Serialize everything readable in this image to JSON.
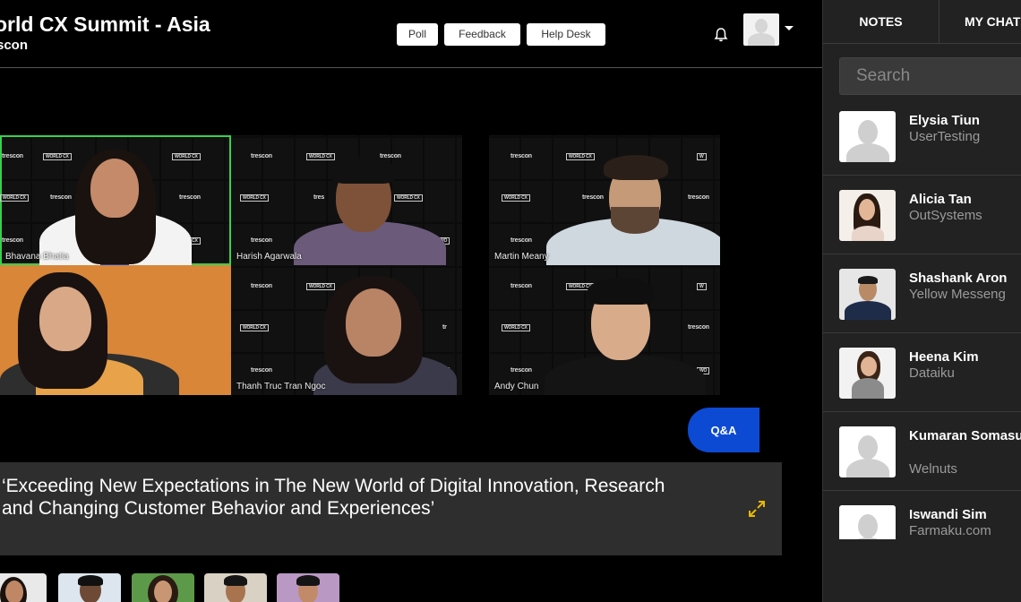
{
  "event": {
    "title": "orld CX Summit - Asia",
    "organizer": "scon"
  },
  "header": {
    "buttons": [
      "Poll",
      "Feedback",
      "Help Desk"
    ],
    "icons": [
      "bell-icon",
      "user-avatar",
      "caret-down-icon"
    ]
  },
  "stage": {
    "backdrop_brand": "trescon",
    "backdrop_logo": "WORLD CX SUMMIT",
    "speakers": [
      {
        "name": "Bhavana Bhatia",
        "active": true
      },
      {
        "name": "Harish Agarwala",
        "active": false
      },
      {
        "name": "Martin Meany",
        "active": false
      },
      {
        "name": "",
        "active": false
      },
      {
        "name": "Thanh Truc Tran Ngoc",
        "active": false
      },
      {
        "name": "Andy Chun",
        "active": false
      }
    ],
    "qa_label": "Q&A"
  },
  "session": {
    "title": "‘Exceeding New Expectations in The New World of Digital Innovation, Research and Changing Customer Behavior and Experiences’"
  },
  "panel": {
    "tabs": [
      "NOTES",
      "MY CHAT"
    ],
    "search_placeholder": "Search",
    "attendees": [
      {
        "name": "Elysia Tiun",
        "company": "UserTesting",
        "photo": false
      },
      {
        "name": "Alicia Tan",
        "company": "OutSystems",
        "photo": true
      },
      {
        "name": "Shashank Aron",
        "company": "Yellow Messeng",
        "photo": true
      },
      {
        "name": "Heena Kim",
        "company": "Dataiku",
        "photo": true
      },
      {
        "name": "Kumaran Somasundram",
        "company": "Welnuts",
        "photo": false
      },
      {
        "name": "Iswandi Sim",
        "company": "Farmaku.com",
        "photo": false
      }
    ]
  },
  "colors": {
    "active_speaker": "#37d14e",
    "qa_button": "#0c4ad4",
    "panel_bg": "#222222",
    "expand_icon": "#e8b800"
  }
}
